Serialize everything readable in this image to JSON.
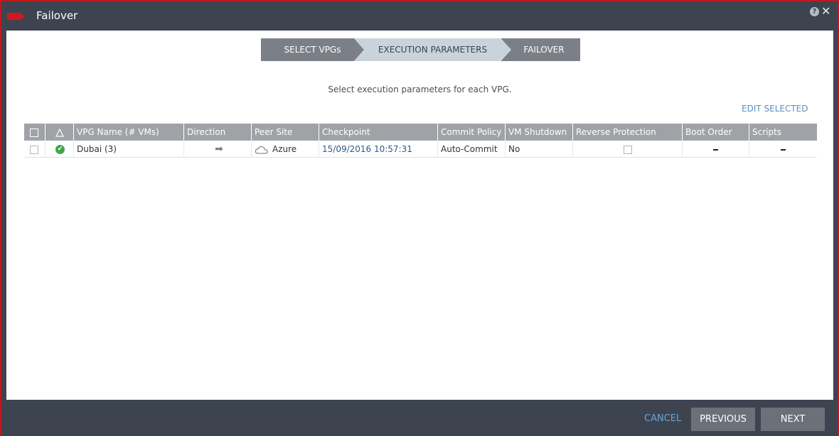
{
  "window": {
    "title": "Failover",
    "help_glyph": "?",
    "close_glyph": "✕"
  },
  "wizard": {
    "steps": [
      {
        "label": "SELECT VPGs"
      },
      {
        "label": "EXECUTION PARAMETERS"
      },
      {
        "label": "FAILOVER"
      }
    ],
    "active_step": 2
  },
  "instruction": "Select execution parameters for each VPG.",
  "edit_selected": "EDIT SELECTED",
  "table": {
    "headers": [
      "VPG Name (# VMs)",
      "Direction",
      "Peer Site",
      "Checkpoint",
      "Commit Policy",
      "VM Shutdown",
      "Reverse Protection",
      "Boot Order",
      "Scripts"
    ],
    "rows": [
      {
        "status_glyph": "✔",
        "vpg_name": "Dubai (3)",
        "direction_glyph": "➡",
        "peer_site": "Azure",
        "checkpoint": "15/09/2016 10:57:31",
        "commit_policy": "Auto-Commit",
        "vm_shutdown": "No"
      }
    ]
  },
  "footer": {
    "cancel": "CANCEL",
    "previous": "PREVIOUS",
    "next": "NEXT"
  },
  "colors": {
    "accent_red": "#c0181c",
    "header_bg": "#3d4450",
    "link_blue": "#5a8fbe",
    "status_green": "#3ea648"
  }
}
